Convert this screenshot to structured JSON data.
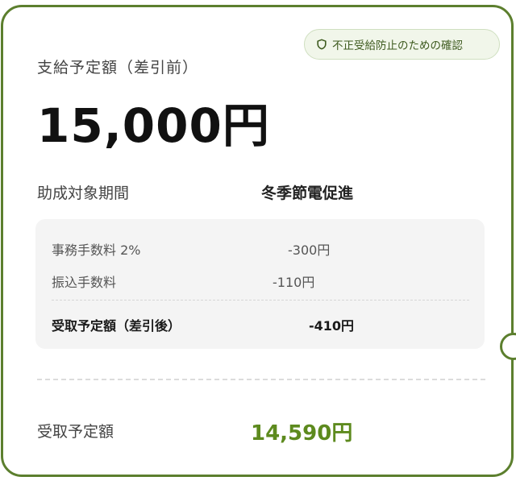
{
  "badge": {
    "icon": "shield-icon",
    "label": "不正受給防止のための確認",
    "color": "#3d5a1e"
  },
  "payment": {
    "label": "支給予定額（差引前）",
    "amount": "15,000円"
  },
  "period": {
    "label": "助成対象期間",
    "value": "冬季節電促進"
  },
  "fees": {
    "items": [
      {
        "label": "事務手数料 2%",
        "value": "-300円"
      },
      {
        "label": "振込手数料",
        "value": "-110円"
      }
    ],
    "total_label": "受取予定額（差引後）",
    "total_value": "-410円"
  },
  "receive": {
    "label": "受取予定額",
    "amount": "14,590円",
    "color": "#5d8a1e"
  },
  "colors": {
    "border": "#5c7f2e",
    "badge_bg": "#f1f6ea",
    "fee_box_bg": "#f4f4f4"
  }
}
